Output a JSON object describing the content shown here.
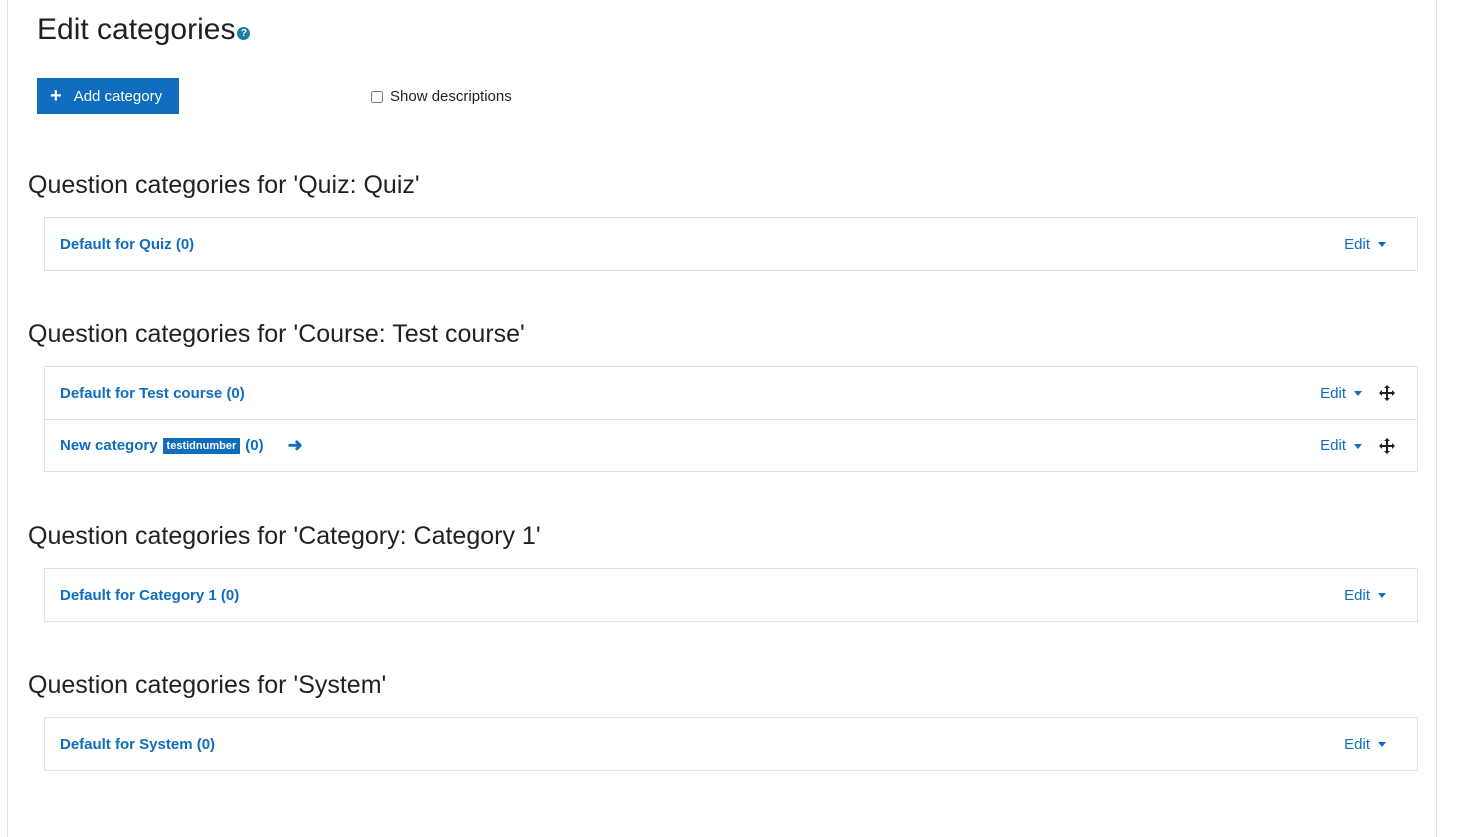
{
  "page": {
    "title": "Edit categories",
    "help_icon": "question-circle-icon"
  },
  "toolbar": {
    "add_label": "Add category",
    "add_icon": "plus-icon",
    "show_descriptions_label": "Show descriptions",
    "show_descriptions_checked": false
  },
  "sections": [
    {
      "heading": "Question categories for 'Quiz: Quiz'",
      "items": [
        {
          "name": "Default for Quiz",
          "count": "(0)",
          "edit": "Edit"
        }
      ]
    },
    {
      "heading": "Question categories for 'Course: Test course'",
      "items": [
        {
          "name": "Default for Test course",
          "count": "(0)",
          "edit": "Edit"
        },
        {
          "name": "New category",
          "idnumber": "testidnumber",
          "count": "(0)",
          "edit": "Edit"
        }
      ]
    },
    {
      "heading": "Question categories for 'Category: Category 1'",
      "items": [
        {
          "name": "Default for Category 1",
          "count": "(0)",
          "edit": "Edit"
        }
      ]
    },
    {
      "heading": "Question categories for 'System'",
      "items": [
        {
          "name": "Default for System",
          "count": "(0)",
          "edit": "Edit"
        }
      ]
    }
  ],
  "colors": {
    "primary": "#0f6cbf",
    "text": "#1d2125",
    "border": "#dee2e6"
  }
}
